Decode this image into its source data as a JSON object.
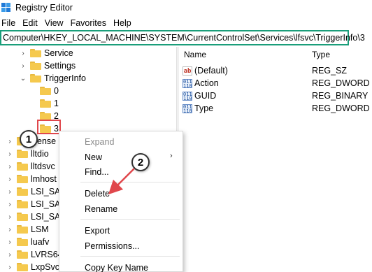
{
  "window": {
    "title": "Registry Editor",
    "icon": "registry-app-icon"
  },
  "menubar": [
    "File",
    "Edit",
    "View",
    "Favorites",
    "Help"
  ],
  "address": "Computer\\HKEY_LOCAL_MACHINE\\SYSTEM\\CurrentControlSet\\Services\\lfsvc\\TriggerInfo\\3",
  "tree": {
    "service": "Service",
    "settings": "Settings",
    "triggerinfo": "TriggerInfo",
    "k0": "0",
    "k1": "1",
    "k2": "2",
    "k3": "3",
    "license": "icense",
    "lltdio": "lltdio",
    "lltdsvc": "lltdsvc",
    "lmhosts": "lmhost",
    "lsi_sas": "LSI_SAS",
    "lsi_sas2": "LSI_SAS",
    "lsi_sas3": "LSI_SAS",
    "lsm": "LSM",
    "luafv": "luafv",
    "lvrs64": "LVRS64",
    "lxpsvc": "LxpSvc"
  },
  "list": {
    "headers": {
      "name": "Name",
      "type": "Type"
    },
    "rows": [
      {
        "name": "(Default)",
        "type": "REG_SZ",
        "icon": "string-value-icon"
      },
      {
        "name": "Action",
        "type": "REG_DWORD",
        "icon": "binary-value-icon"
      },
      {
        "name": "GUID",
        "type": "REG_BINARY",
        "icon": "binary-value-icon"
      },
      {
        "name": "Type",
        "type": "REG_DWORD",
        "icon": "binary-value-icon"
      }
    ]
  },
  "context_menu": {
    "expand": "Expand",
    "new": "New",
    "find": "Find...",
    "delete": "Delete",
    "rename": "Rename",
    "export": "Export",
    "permissions": "Permissions...",
    "copy_key_name": "Copy Key Name"
  },
  "annotations": {
    "step1": "1",
    "step2": "2"
  },
  "colors": {
    "address_border": "#1a9e7a",
    "highlight": "#e0474c",
    "folder": "#f5c94e"
  }
}
